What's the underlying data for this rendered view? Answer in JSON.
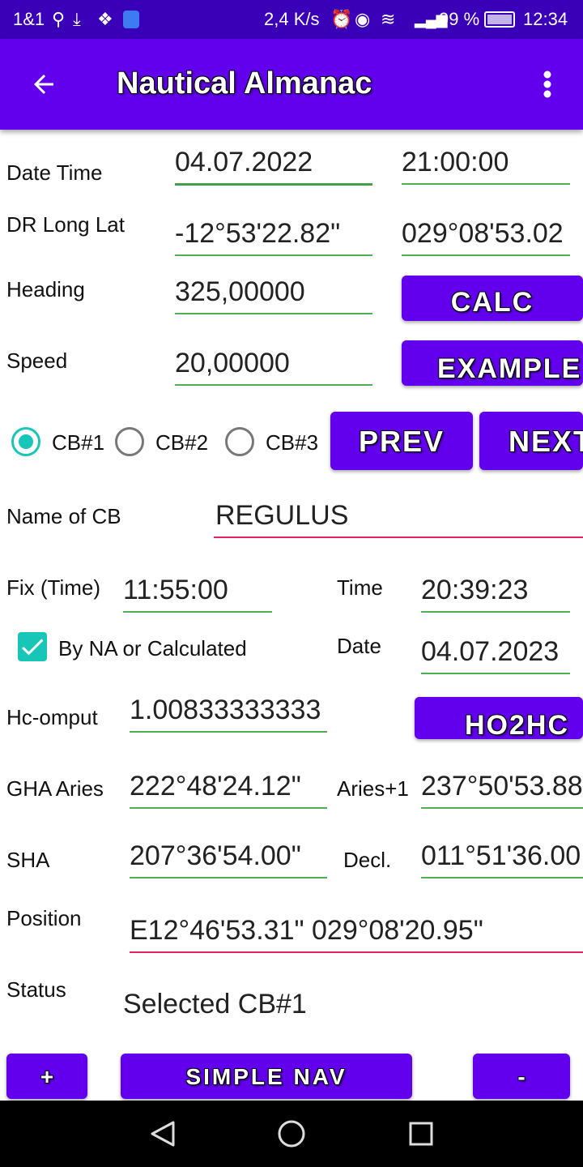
{
  "status_bar": {
    "carrier": "1&1",
    "speed": "2,4 K/s",
    "battery": "99 %",
    "time": "12:34"
  },
  "app_bar": {
    "title": "Nautical Almanac",
    "back_icon": "arrow-left-icon",
    "menu_icon": "more-vert-icon"
  },
  "form": {
    "datetime_label": "Date Time",
    "date_value": "04.07.2022",
    "time_value": "21:00:00",
    "drlonglat_label": "DR Long Lat",
    "long_value": "-12°53'22.82\"",
    "lat_value": "029°08'53.02",
    "heading_label": "Heading",
    "heading_value": "325,00000",
    "speed_label": "Speed",
    "speed_value": "20,00000",
    "calc_label": "CALC",
    "example_label": "EXAMPLE"
  },
  "cb": {
    "options": [
      "CB#1",
      "CB#2",
      "CB#3"
    ],
    "selected": "CB#1",
    "prev_label": "PREV",
    "next_label": "NEXT",
    "name_label": "Name of CB",
    "name_value": "REGULUS"
  },
  "fix": {
    "fix_label": "Fix (Time)",
    "fix_value": "11:55:00",
    "time_label": "Time",
    "time_value": "20:39:23",
    "checkbox_label": "By NA or Calculated",
    "checkbox_checked": true,
    "date_label": "Date",
    "date_value": "04.07.2023",
    "hc_label": "Hc-omput",
    "hc_value": "1.00833333333",
    "ho2hc_label": "HO2HC",
    "gha_label": "GHA Aries",
    "gha_value": "222°48'24.12\"",
    "aries1_label": "Aries+1",
    "aries1_value": "237°50'53.88",
    "sha_label": "SHA",
    "sha_value": "207°36'54.00\"",
    "decl_label": "Decl.",
    "decl_value": "011°51'36.00",
    "position_label": "Position",
    "position_value": "E12°46'53.31\" 029°08'20.95\"",
    "status_label": "Status",
    "status_value": "Selected CB#1"
  },
  "bottom": {
    "plus_label": "+",
    "simplenav_label": "SIMPLE NAV",
    "minus_label": "-"
  },
  "colors": {
    "accent": "#6200ee",
    "status_bar": "#3a00b8",
    "teal": "#18c6b8",
    "underline_green": "#4caf50",
    "underline_pink": "#e0245e"
  }
}
